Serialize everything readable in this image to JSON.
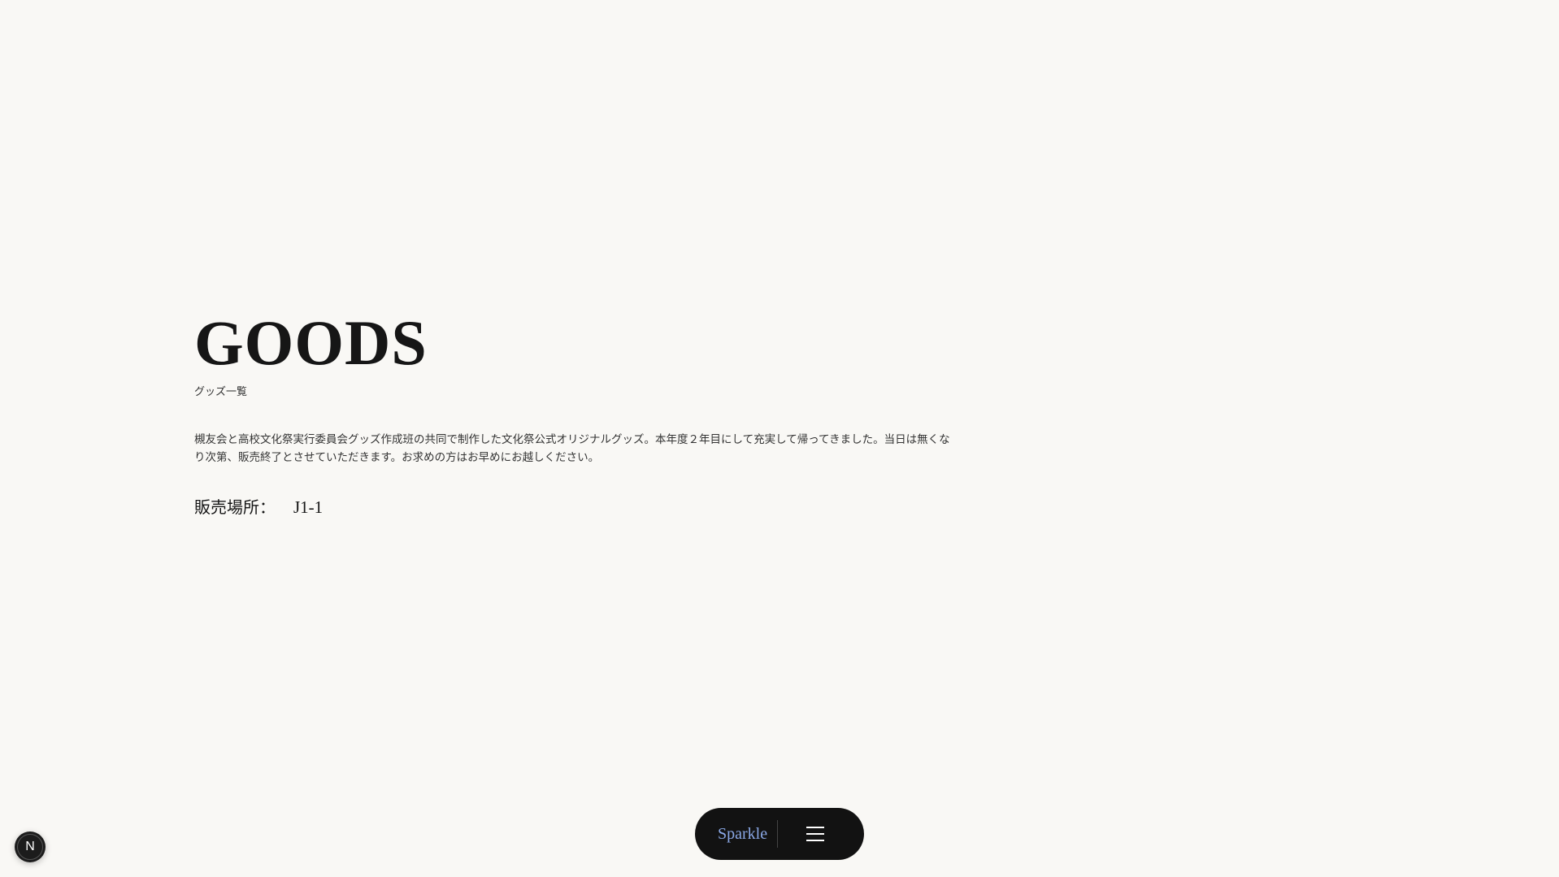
{
  "header": {
    "title": "GOODS",
    "subtitle": "グッズ一覧"
  },
  "main": {
    "description": "槻友会と高校文化祭実行委員会グッズ作成班の共同で制作した文化祭公式オリジナルグッズ。本年度２年目にして充実して帰ってきました。当日は無くなり次第、販売終了とさせていただきます。お求めの方はお早めにお越しください。",
    "location_label": "販売場所：",
    "location_value": "J1-1"
  },
  "bottom_nav": {
    "brand": "Sparkle",
    "menu_icon": "hamburger-menu-icon"
  },
  "dev_badge": {
    "letter": "N"
  },
  "colors": {
    "background": "#f9f8f5",
    "nav_background": "#121212",
    "brand_accent": "#8aa8e6"
  }
}
